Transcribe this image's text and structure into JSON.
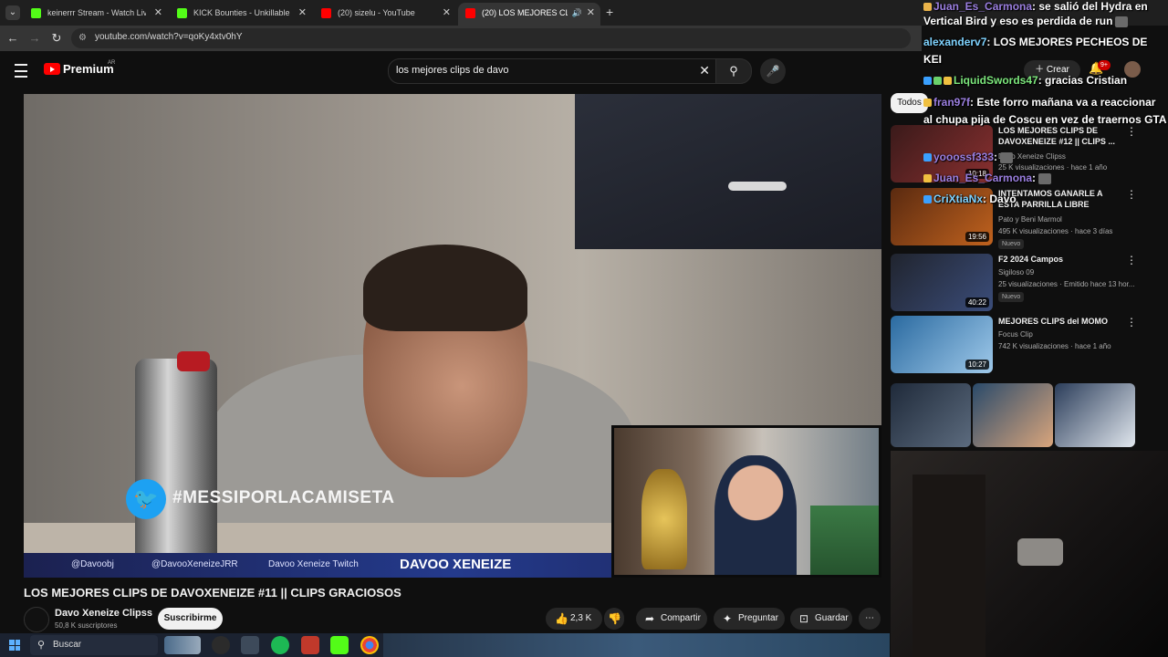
{
  "browser": {
    "tabs": [
      {
        "title": "keinerrr Stream - Watch Live on",
        "active": false,
        "favicon_color": "#53fc18"
      },
      {
        "title": "KICK Bounties - Unkillable Dem",
        "active": false,
        "favicon_color": "#53fc18"
      },
      {
        "title": "(20) sizelu - YouTube",
        "active": false,
        "favicon_color": "#ff0000"
      },
      {
        "title": "(20) LOS MEJORES CLIPS DE",
        "active": true,
        "favicon_color": "#ff0000"
      }
    ],
    "url": "youtube.com/watch?v=qoKy4xtv0hY"
  },
  "youtube": {
    "brand": "Premium",
    "country": "AR",
    "search_query": "los mejores clips de davo",
    "create_label": "Crear",
    "notifications": "9+",
    "video": {
      "overlay_hashtag": "#MESSIPORLACAMISETA",
      "lower_bar": {
        "instagram": "@Davoobj",
        "twitter": "@DavooXeneizeJRR",
        "twitch": "Davoo Xeneize Twitch",
        "brand": "DAVOO XENEIZE"
      },
      "title": "LOS MEJORES CLIPS DE DAVOXENEIZE #11 || CLIPS GRACIOSOS"
    },
    "channel": {
      "name": "Davo Xeneize Clipss",
      "subscribers": "50,8 K suscriptores",
      "subscribe_label": "Suscribirme"
    },
    "actions": {
      "likes": "2,3 K",
      "share": "Compartir",
      "ask": "Preguntar",
      "save": "Guardar"
    },
    "chip": "Todos",
    "recommendations": [
      {
        "title": "LOS MEJORES CLIPS DE DAVOXENEIZE #12 || CLIPS ...",
        "channel": "Davo Xeneize Clipss",
        "meta": "25 K visualizaciones · hace 1 año",
        "duration": "10:18",
        "nuevo": ""
      },
      {
        "title": "INTENTAMOS GANARLE A ESTA PARRILLA LIBRE",
        "channel": "Pato y Beni Marmol",
        "meta": "495 K visualizaciones · hace 3 días",
        "duration": "19:56",
        "nuevo": "Nuevo"
      },
      {
        "title": "F2 2024 Campos",
        "channel": "Sigiloso 09",
        "meta": "25 visualizaciones · Emitido hace 13 hor...",
        "duration": "40:22",
        "nuevo": "Nuevo"
      },
      {
        "title": "MEJORES CLIPS del MOMO",
        "channel": "Focus Clip",
        "meta": "742 K visualizaciones · hace 1 año",
        "duration": "10:27",
        "nuevo": ""
      }
    ]
  },
  "chat": [
    {
      "user": "Juan_Es_Carmona",
      "text": ": se salió del Hydra en",
      "color": "purple"
    },
    {
      "user": "",
      "text": "Vertical Bird y eso es perdida de run",
      "color": ""
    },
    {
      "user": "alexanderv7",
      "text": ": LOS MEJORES PECHEOS DE",
      "color": "blue"
    },
    {
      "user": "",
      "text": "KEI",
      "color": ""
    },
    {
      "user": "LiquidSwords47",
      "text": ": gracias Cristian",
      "color": "green"
    },
    {
      "user": "fran97f",
      "text": ": Este forro mañana va a reaccionar",
      "color": "purple"
    },
    {
      "user": "",
      "text": "al chupa pija de Coscu en vez de traernos GTA",
      "color": ""
    },
    {
      "user": "yooossf333",
      "text": ":",
      "color": "purple"
    },
    {
      "user": "Juan_Es_Carmona",
      "text": ":",
      "color": "purple"
    },
    {
      "user": "CriXtiaNx",
      "text": ": Davo",
      "color": "blue"
    }
  ],
  "taskbar": {
    "search_label": "Buscar"
  }
}
